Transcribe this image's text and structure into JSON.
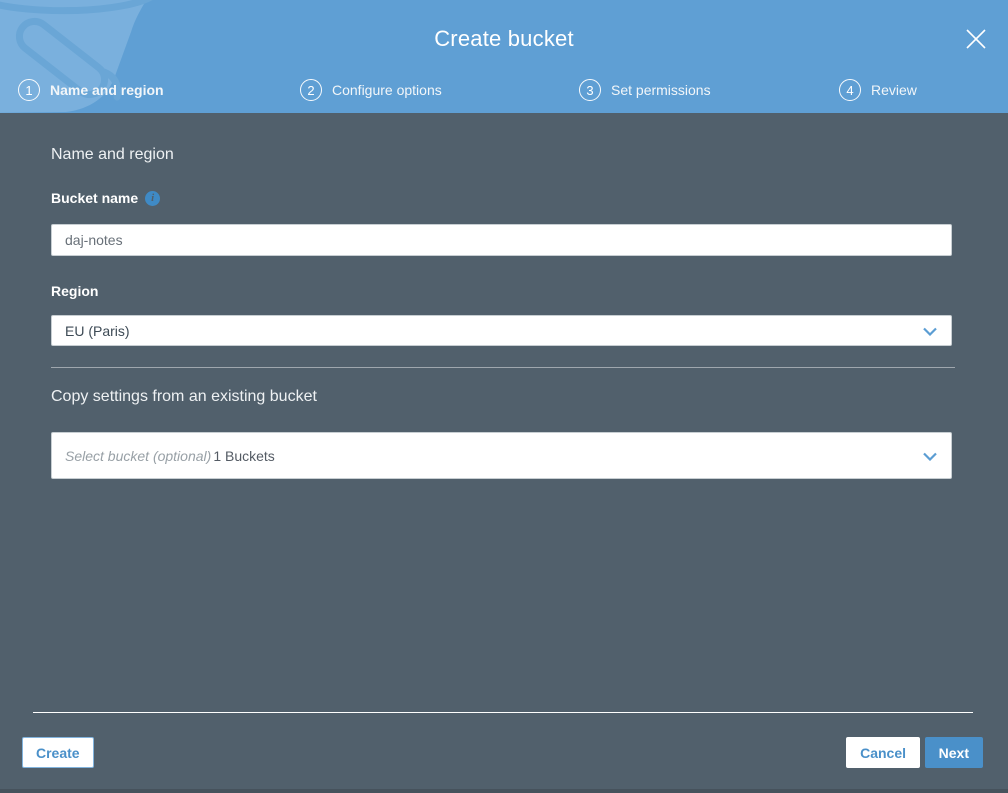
{
  "modal": {
    "title": "Create bucket"
  },
  "steps": [
    {
      "number": "1",
      "label": "Name and region",
      "active": true
    },
    {
      "number": "2",
      "label": "Configure options",
      "active": false
    },
    {
      "number": "3",
      "label": "Set permissions",
      "active": false
    },
    {
      "number": "4",
      "label": "Review",
      "active": false
    }
  ],
  "form": {
    "section_heading": "Name and region",
    "bucket_name_label": "Bucket name",
    "bucket_name_value": "daj-notes",
    "info_icon_glyph": "i",
    "region_label": "Region",
    "region_selected": "EU (Paris)",
    "copy_settings_heading": "Copy settings from an existing bucket",
    "bucket_select_placeholder": "Select bucket (optional)",
    "bucket_select_suffix": "1 Buckets"
  },
  "footer": {
    "create_label": "Create",
    "cancel_label": "Cancel",
    "next_label": "Next"
  },
  "colors": {
    "header_blue": "#5f9fd4",
    "body_slate": "#51606c",
    "accent_blue": "#4a90c9",
    "decoration_blue": "#7ab0dd"
  }
}
